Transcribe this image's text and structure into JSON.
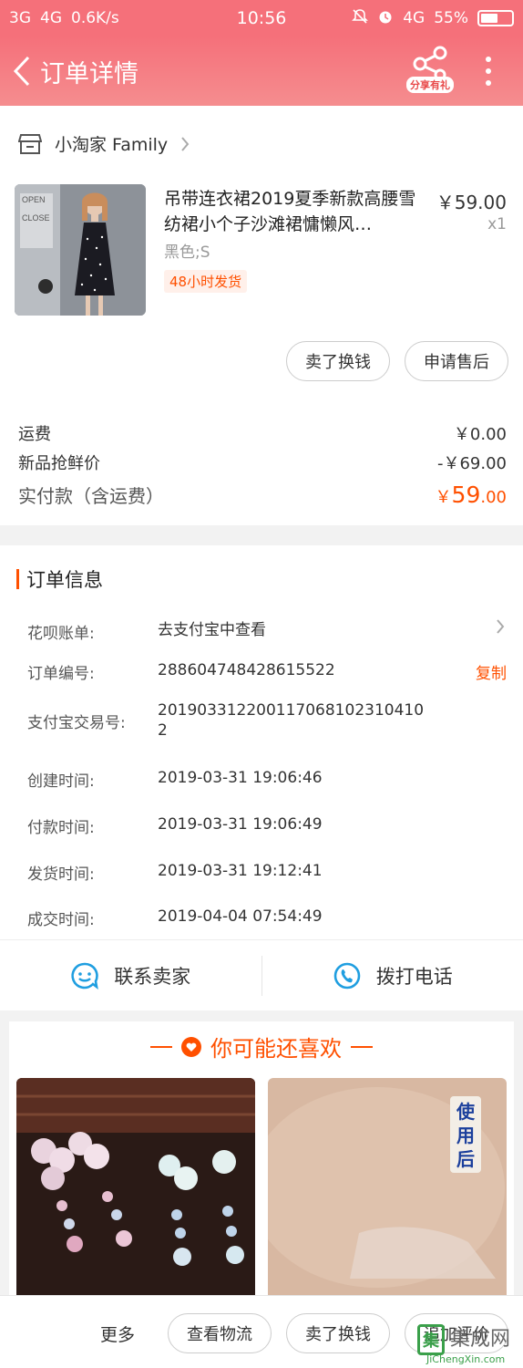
{
  "status_bar": {
    "net1": "3G",
    "net2": "4G",
    "speed": "0.6K/s",
    "time": "10:56",
    "net3": "4G",
    "battery": "55%",
    "battery_level": 0.55
  },
  "nav": {
    "title": "订单详情",
    "share_label": "分享有礼"
  },
  "shop": {
    "name": "小淘家 Family"
  },
  "product": {
    "title": "吊带连衣裙2019夏季新款高腰雪纺裙小个子沙滩裙慵懒风…",
    "price": "￥59.00",
    "qty": "x1",
    "sku": "黑色;S",
    "tag": "48小时发货",
    "thumb_text1": "OPEN",
    "thumb_text2": "CLOSE"
  },
  "item_actions": {
    "sell": "卖了换钱",
    "after_sale": "申请售后"
  },
  "fees": [
    {
      "label": "运费",
      "value": "￥0.00"
    },
    {
      "label": "新品抢鲜价",
      "value": "-￥69.00"
    }
  ],
  "total": {
    "label": "实付款（含运费）",
    "currency": "￥",
    "int": "59",
    "dec": ".00"
  },
  "order_info": {
    "heading": "订单信息",
    "huabei": {
      "label": "花呗账单:",
      "value": "去支付宝中查看"
    },
    "order_no": {
      "label": "订单编号:",
      "value": "288604748428615522",
      "action": "复制"
    },
    "alipay_no": {
      "label": "支付宝交易号:",
      "value": "2019033122001170681023104102"
    },
    "created": {
      "label": "创建时间:",
      "value": "2019-03-31 19:06:46"
    },
    "paid": {
      "label": "付款时间:",
      "value": "2019-03-31 19:06:49"
    },
    "shipped": {
      "label": "发货时间:",
      "value": "2019-03-31 19:12:41"
    },
    "completed": {
      "label": "成交时间:",
      "value": "2019-04-04 07:54:49"
    }
  },
  "contact": {
    "seller": "联系卖家",
    "phone": "拨打电话"
  },
  "recommend": {
    "title": "你可能还喜欢",
    "right_overlay": "使用后"
  },
  "bottom": {
    "more": "更多",
    "logistics": "查看物流",
    "sell": "卖了换钱",
    "review": "追加评价"
  },
  "watermark": {
    "name": "集成网",
    "url": "JiChengXin.com"
  },
  "colors": {
    "header": "#f5707a",
    "accent": "#ff5000",
    "contact_icon": "#1f9ee0"
  }
}
